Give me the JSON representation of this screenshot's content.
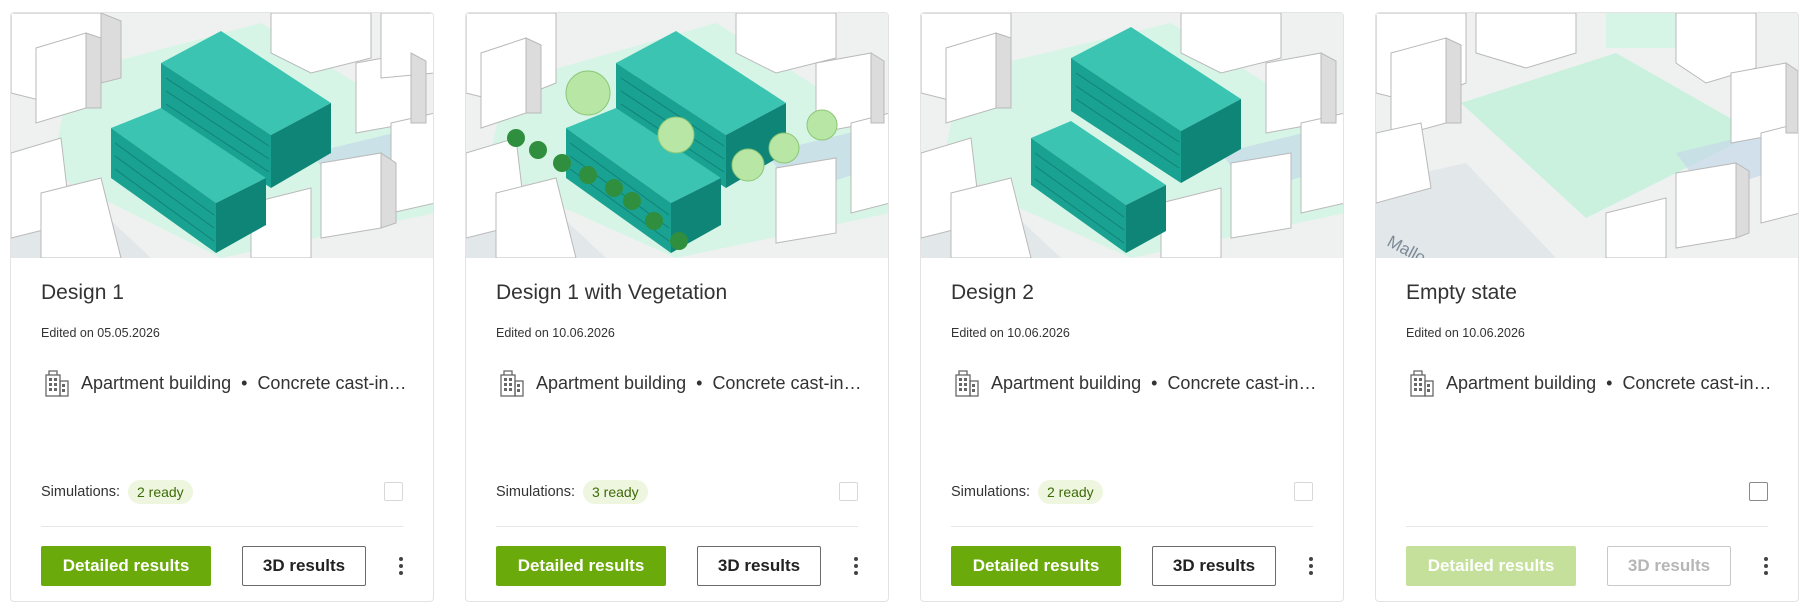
{
  "colors": {
    "primary": "#6aab0b",
    "primary_disabled": "#c4e09a",
    "building_teal": "#1fa99a",
    "green_area": "#d6f5e6",
    "badge_bg": "#eef6df",
    "badge_text": "#3d6b06"
  },
  "cards": [
    {
      "title": "Design 1",
      "edited": "Edited on 05.05.2026",
      "building_type": "Apartment building",
      "separator": "•",
      "construction": "Concrete cast-in…",
      "simulations_label": "Simulations:",
      "simulations_badge": "2 ready",
      "detailed_label": "Detailed results",
      "results3d_label": "3D results",
      "disabled": false
    },
    {
      "title": "Design 1 with Vegetation",
      "edited": "Edited on 10.06.2026",
      "building_type": "Apartment building",
      "separator": "•",
      "construction": "Concrete cast-in…",
      "simulations_label": "Simulations:",
      "simulations_badge": "3 ready",
      "detailed_label": "Detailed results",
      "results3d_label": "3D results",
      "disabled": false
    },
    {
      "title": "Design 2",
      "edited": "Edited on 10.06.2026",
      "building_type": "Apartment building",
      "separator": "•",
      "construction": "Concrete cast-in…",
      "simulations_label": "Simulations:",
      "simulations_badge": "2 ready",
      "detailed_label": "Detailed results",
      "results3d_label": "3D results",
      "disabled": false
    },
    {
      "title": "Empty state",
      "edited": "Edited on 10.06.2026",
      "building_type": "Apartment building",
      "separator": "•",
      "construction": "Concrete cast-in…",
      "detailed_label": "Detailed results",
      "results3d_label": "3D results",
      "map_label": "Mallo",
      "disabled": true
    }
  ]
}
